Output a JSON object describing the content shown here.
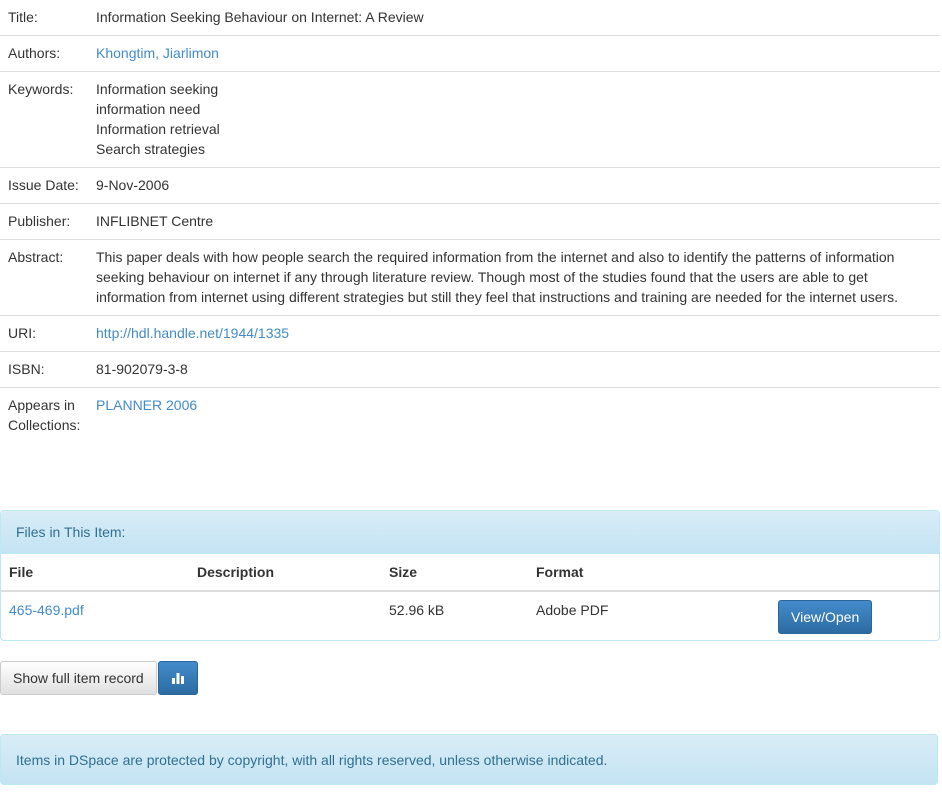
{
  "item": {
    "fields": [
      {
        "key": "title",
        "label": "Title:",
        "values": [
          "Information Seeking Behaviour on Internet: A Review"
        ],
        "link": false
      },
      {
        "key": "authors",
        "label": "Authors:",
        "values": [
          "Khongtim, Jiarlimon"
        ],
        "link": true
      },
      {
        "key": "keywords",
        "label": "Keywords:",
        "values": [
          "Information seeking",
          "information need",
          "Information retrieval",
          "Search strategies"
        ],
        "link": false
      },
      {
        "key": "issue-date",
        "label": "Issue Date:",
        "values": [
          "9-Nov-2006"
        ],
        "link": false
      },
      {
        "key": "publisher",
        "label": "Publisher:",
        "values": [
          "INFLIBNET Centre"
        ],
        "link": false
      },
      {
        "key": "abstract",
        "label": "Abstract:",
        "values": [
          "This paper deals with how people search the required information from the internet and also to identify the patterns of information seeking behaviour on internet if any through literature review. Though most of the studies found that the users are able to get information from internet using different strategies but still they feel that instructions and training are needed for the internet users."
        ],
        "link": false
      },
      {
        "key": "uri",
        "label": "URI:",
        "values": [
          "http://hdl.handle.net/1944/1335"
        ],
        "link": true
      },
      {
        "key": "isbn",
        "label": "ISBN:",
        "values": [
          "81-902079-3-8"
        ],
        "link": false
      },
      {
        "key": "collections",
        "label": "Appears in Collections:",
        "values": [
          "PLANNER 2006"
        ],
        "link": true
      }
    ]
  },
  "files": {
    "heading": "Files in This Item:",
    "columns": {
      "file": "File",
      "description": "Description",
      "size": "Size",
      "format": "Format"
    },
    "rows": [
      {
        "file": "465-469.pdf",
        "description": "",
        "size": "52.96 kB",
        "format": "Adobe PDF",
        "action": "View/Open"
      }
    ]
  },
  "actions": {
    "full_record": "Show full item record",
    "stats_icon": "bar-chart-icon"
  },
  "footer": {
    "notice": "Items in DSpace are protected by copyright, with all rights reserved, unless otherwise indicated."
  },
  "colors": {
    "link": "#428bca",
    "primary": "#428bca",
    "info_bg": "#d9edf7",
    "info_text": "#31708f"
  }
}
